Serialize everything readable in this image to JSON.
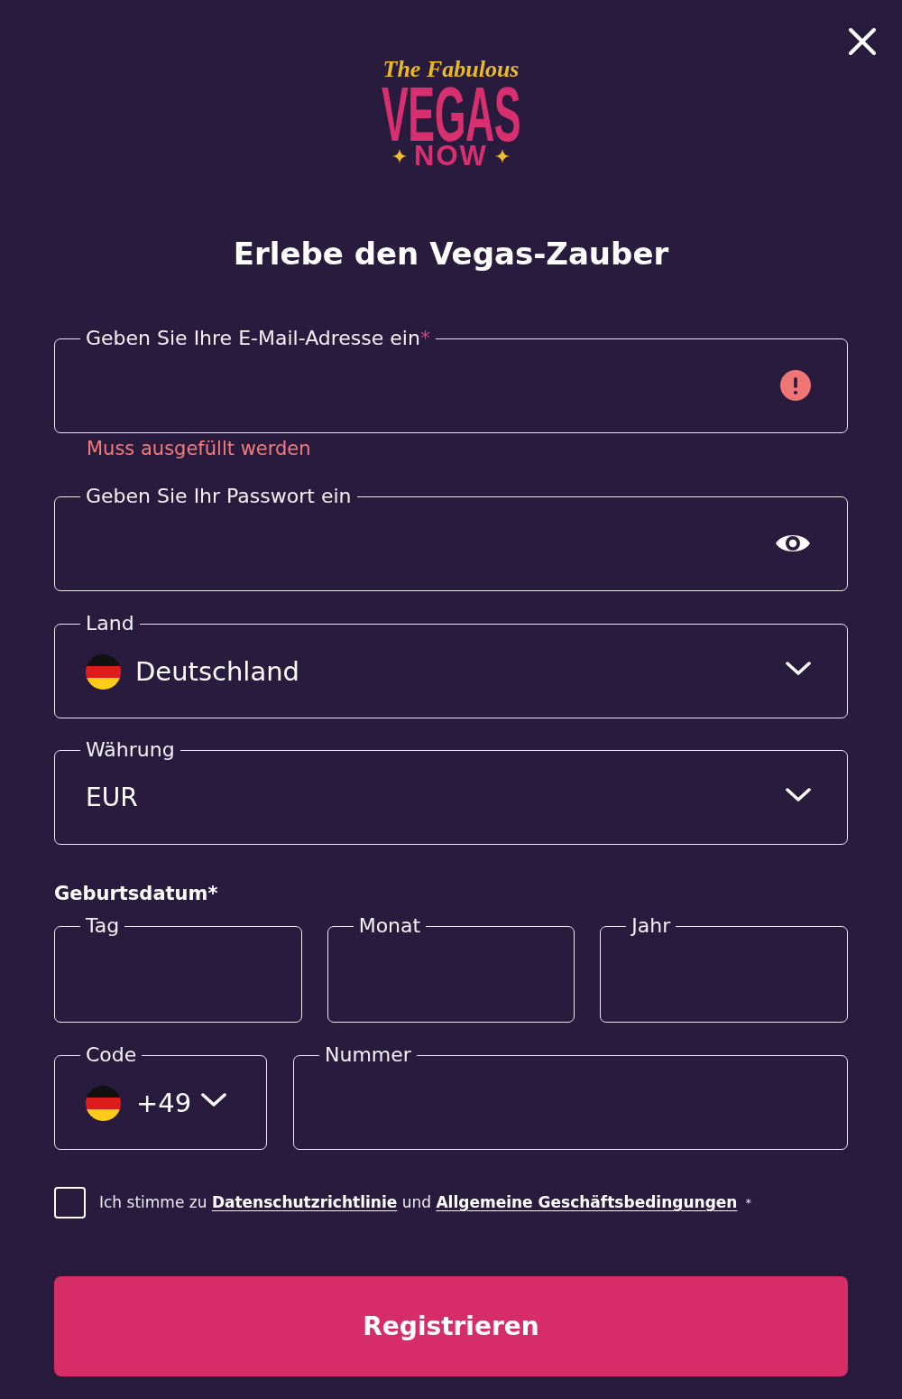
{
  "logo": {
    "tagline": "The Fabulous",
    "title": "VEGAS",
    "subtitle": "NOW"
  },
  "heading": "Erlebe den Vegas-Zauber",
  "fields": [
    {
      "kind": "email",
      "label": "Geben Sie Ihre E-Mail-Adresse ein",
      "required_mark": "*",
      "invalid": true,
      "message": "Muss ausgefüllt werden"
    },
    {
      "kind": "password",
      "label": "Geben Sie Ihr Passwort ein"
    },
    {
      "kind": "country",
      "label": "Land",
      "value": "Deutschland"
    },
    {
      "kind": "currency",
      "label": "Währung",
      "value": "EUR"
    }
  ],
  "birth_date": {
    "title": "Geburtsdatum*",
    "fields": [
      {
        "label": "Tag"
      },
      {
        "label": "Monat"
      },
      {
        "label": "Jahr"
      }
    ]
  },
  "phone": {
    "code": {
      "label": "Code",
      "value": "+49"
    },
    "number": {
      "label": "Nummer"
    }
  },
  "consent": {
    "checked": false,
    "parts": [
      {
        "kind": "text",
        "text": "Ich stimme zu"
      },
      {
        "kind": "link",
        "text": "Datenschutzrichtlinie"
      },
      {
        "kind": "text",
        "text": "und"
      },
      {
        "kind": "link",
        "text": "Allgemeine Geschäftsbedingungen"
      },
      {
        "kind": "mark",
        "text": "*"
      }
    ]
  },
  "submit_button": {
    "label": "Registrieren"
  }
}
